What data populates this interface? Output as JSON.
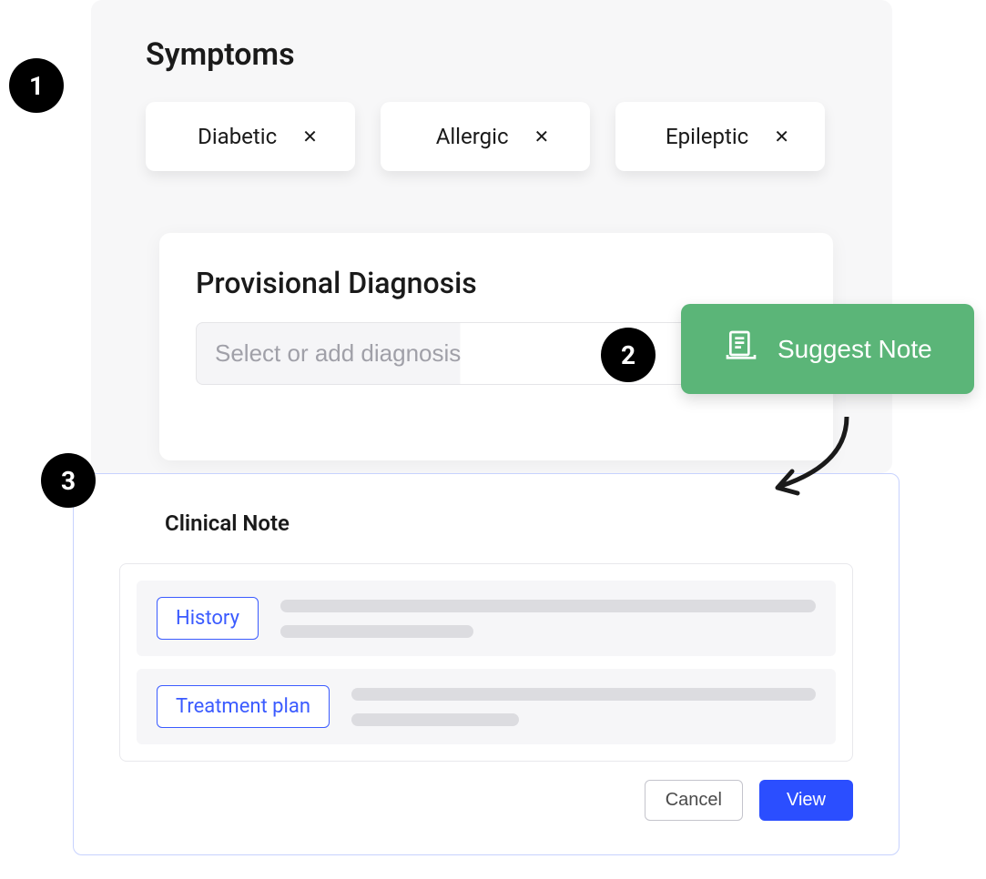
{
  "steps": {
    "one": "1",
    "two": "2",
    "three": "3"
  },
  "symptoms": {
    "title": "Symptoms",
    "chips": [
      {
        "label": "Diabetic"
      },
      {
        "label": "Allergic"
      },
      {
        "label": "Epileptic"
      }
    ]
  },
  "diagnosis": {
    "title": "Provisional Diagnosis",
    "placeholder": "Select or add diagnosis"
  },
  "suggest": {
    "label": "Suggest Note"
  },
  "clinical": {
    "title": "Clinical Note",
    "tags": {
      "history": "History",
      "treatment": "Treatment plan"
    },
    "actions": {
      "cancel": "Cancel",
      "view": "View"
    }
  }
}
